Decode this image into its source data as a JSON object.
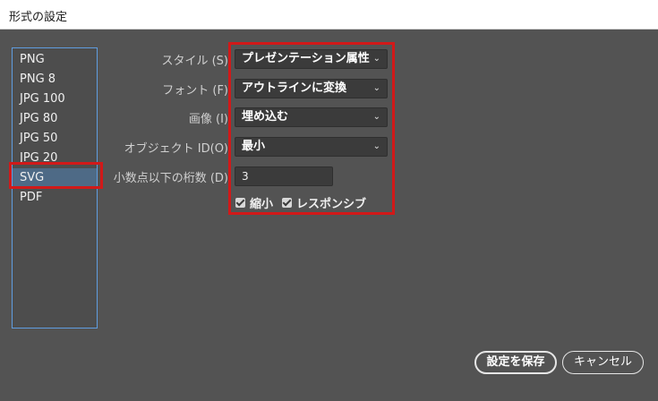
{
  "window": {
    "title": "形式の設定"
  },
  "formats": {
    "items": [
      "PNG",
      "PNG 8",
      "JPG 100",
      "JPG 80",
      "JPG 50",
      "JPG 20",
      "SVG",
      "PDF"
    ],
    "selected": "SVG"
  },
  "options": {
    "style": {
      "label": "スタイル (S)",
      "value": "プレゼンテーション属性"
    },
    "font": {
      "label": "フォント (F)",
      "value": "アウトラインに変換"
    },
    "image": {
      "label": "画像 (I)",
      "value": "埋め込む"
    },
    "object_id": {
      "label": "オブジェクト ID(O)",
      "value": "最小"
    },
    "decimals": {
      "label": "小数点以下の桁数 (D)",
      "value": "3"
    },
    "minify": {
      "label": "縮小",
      "checked": true
    },
    "responsive": {
      "label": "レスポンシブ",
      "checked": true
    }
  },
  "buttons": {
    "save": "設定を保存",
    "cancel": "キャンセル"
  },
  "colors": {
    "background": "#535353",
    "highlight": "#d11919",
    "selection": "#4e6a86",
    "list_border": "#5f9de0"
  }
}
